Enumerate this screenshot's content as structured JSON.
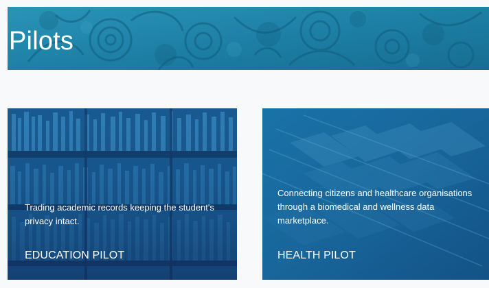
{
  "hero": {
    "title": "Pilots"
  },
  "pilots": [
    {
      "description": "Trading academic records keeping the student's privacy intact.",
      "title": "EDUCATION PILOT",
      "image": "library-bookshelves"
    },
    {
      "description": "Connecting citizens and healthcare organisations through a biomedical and wellness data marketplace.",
      "title": "HEALTH PILOT",
      "image": "medical-file-folders"
    }
  ],
  "colors": {
    "hero_bg": "#1f84a9",
    "education_overlay": "#164f86",
    "health_overlay": "#1769a0",
    "text": "#ffffff",
    "page_bg": "#f8f9fb"
  }
}
